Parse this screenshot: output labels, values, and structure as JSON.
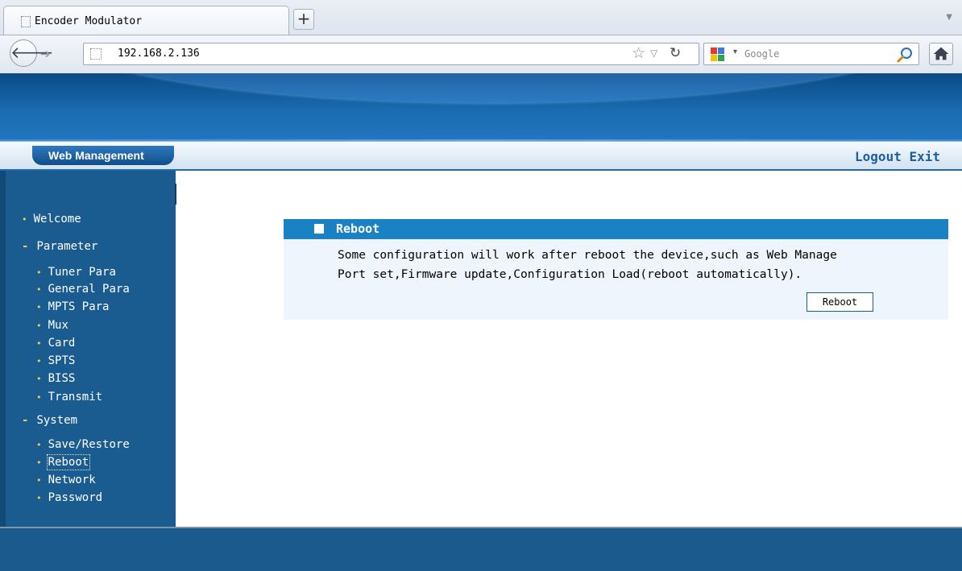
{
  "browser": {
    "tab_title": "Encoder Modulator",
    "new_tab_label": "+",
    "url": "192.168.2.136",
    "search_placeholder": "Google"
  },
  "header": {
    "web_management": "Web Management",
    "logout": "Logout",
    "exit": "Exit"
  },
  "sidebar": {
    "welcome": "Welcome",
    "parameter": "Parameter",
    "parameter_items": [
      "Tuner Para",
      "General Para",
      "MPTS Para",
      "Mux",
      "Card",
      "SPTS",
      "BISS",
      "Transmit"
    ],
    "system": "System",
    "system_items": [
      "Save/Restore",
      "Reboot",
      "Network",
      "Password"
    ]
  },
  "reboot": {
    "title": "Reboot",
    "description_line1": "Some configuration will work after reboot the device,such as Web Manage",
    "description_line2": "Port set,Firmware update,Configuration Load(reboot automatically).",
    "button_label": "Reboot"
  },
  "colors": {
    "banner": "#1a6bb0",
    "sidebar": "#1a5c8f",
    "panel_header": "#1a82c4",
    "panel_body": "#eef5fc",
    "link": "#1c5fa3",
    "bullet": "#f0d14a"
  }
}
